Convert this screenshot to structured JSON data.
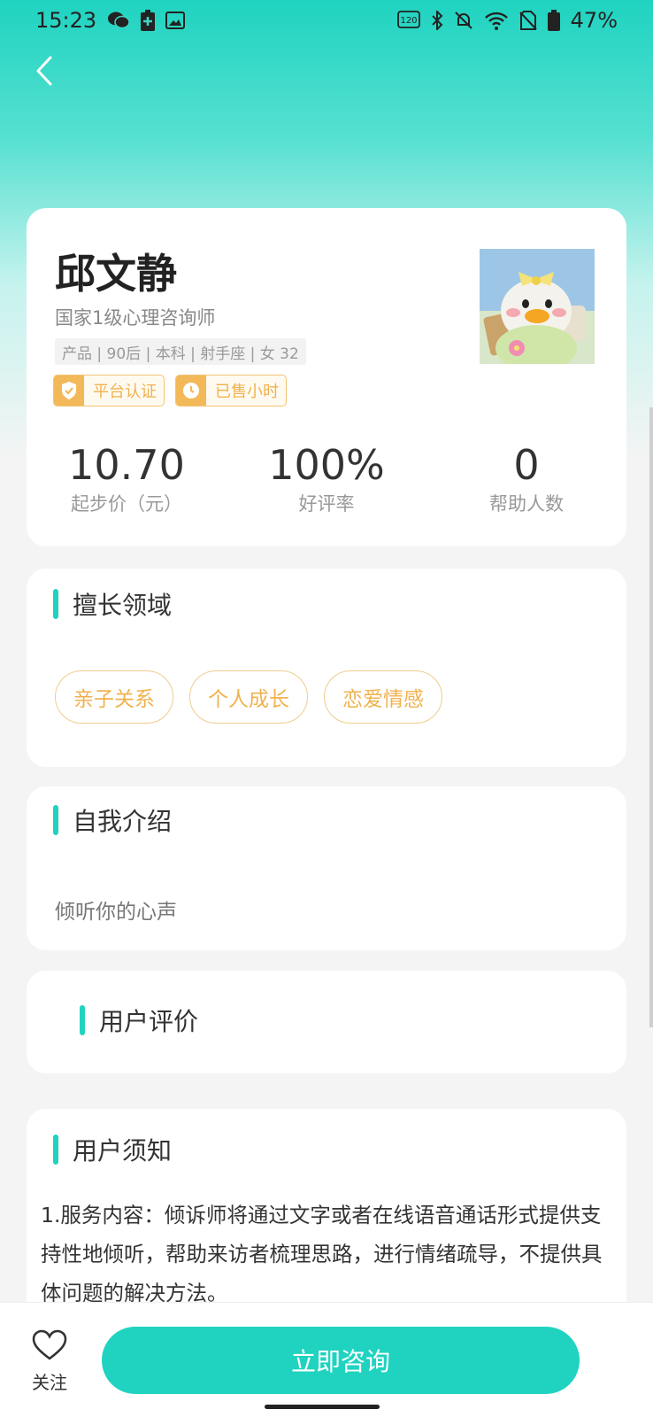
{
  "status_bar": {
    "time": "15:23",
    "battery": "47%",
    "icons": [
      "wechat-icon",
      "battery-saver-icon",
      "gallery-icon",
      "hd-call-icon",
      "bluetooth-icon",
      "mute-icon",
      "wifi-icon",
      "no-sim-icon",
      "battery-icon"
    ]
  },
  "profile": {
    "name": "邱文静",
    "title": "国家1级心理咨询师",
    "meta": "产品 | 90后 | 本科 | 射手座 | 女 32",
    "badges": [
      "平台认证",
      "已售小时"
    ],
    "stats": [
      {
        "value": "10.70",
        "label": "起步价（元）"
      },
      {
        "value": "100%",
        "label": "好评率"
      },
      {
        "value": "0",
        "label": "帮助人数"
      }
    ]
  },
  "skills": {
    "title": "擅长领域",
    "items": [
      "亲子关系",
      "个人成长",
      "恋爱情感"
    ]
  },
  "intro": {
    "title": "自我介绍",
    "text": "倾听你的心声"
  },
  "reviews": {
    "title": "用户评价"
  },
  "notice": {
    "title": "用户须知",
    "text": "1.服务内容：倾诉师将通过文字或者在线语音通话形式提供支持性地倾听，帮助来访者梳理思路，进行情绪疏导，不提供具体问题的解决方法。"
  },
  "bottom": {
    "follow_label": "关注",
    "consult_label": "立即咨询"
  },
  "colors": {
    "accent": "#1fd3c0",
    "badge": "#f3b858",
    "chip_text": "#f0b24f"
  }
}
